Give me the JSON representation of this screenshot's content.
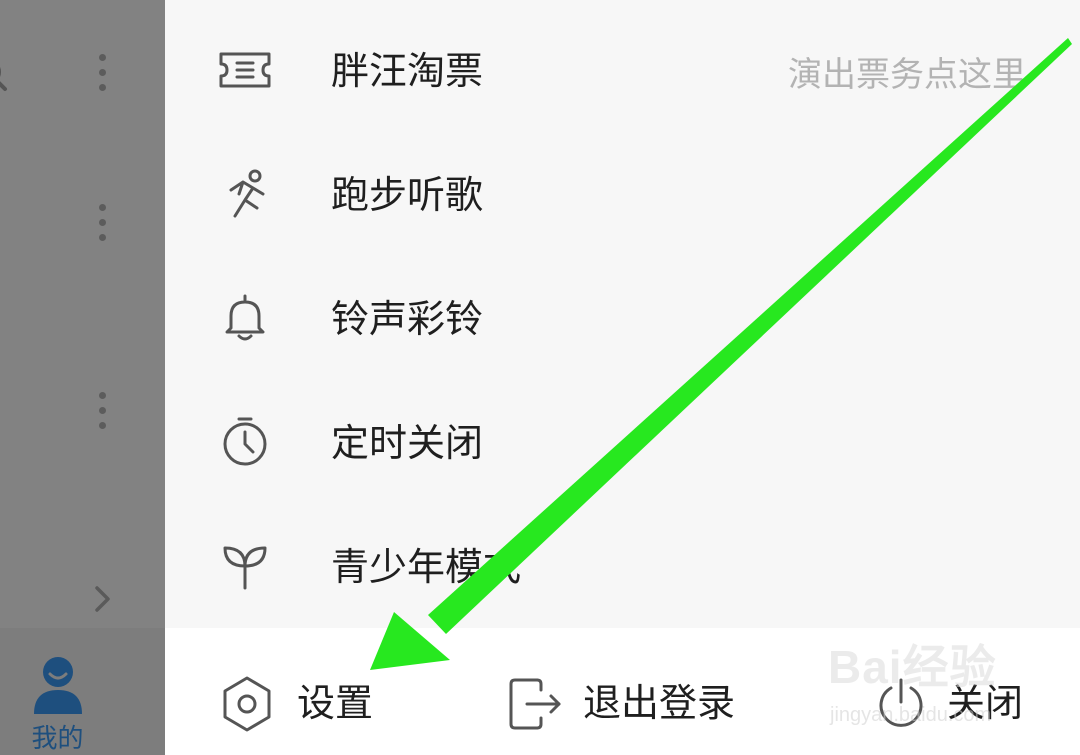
{
  "background": {
    "tab_mine_label": "我的",
    "tab_mine_color": "#1e4f7e"
  },
  "drawer": {
    "menu_items": [
      {
        "icon": "ticket-icon",
        "label": "胖汪淘票",
        "hint": "演出票务点这里"
      },
      {
        "icon": "running-icon",
        "label": "跑步听歌"
      },
      {
        "icon": "bell-icon",
        "label": "铃声彩铃"
      },
      {
        "icon": "timer-icon",
        "label": "定时关闭"
      },
      {
        "icon": "sprout-icon",
        "label": "青少年模式"
      }
    ],
    "bottom_bar": {
      "settings_label": "设置",
      "logout_label": "退出登录",
      "close_label": "关闭"
    }
  },
  "watermark": {
    "brand": "Bai经验",
    "url": "jingyan.baidu.com"
  },
  "colors": {
    "overlay_gray": "#828282",
    "drawer_bg": "#f7f7f7",
    "text_primary": "#1f1f1f",
    "text_hint": "#b3b3b3",
    "icon_stroke": "#555555",
    "annotation_arrow": "#27e81f"
  }
}
